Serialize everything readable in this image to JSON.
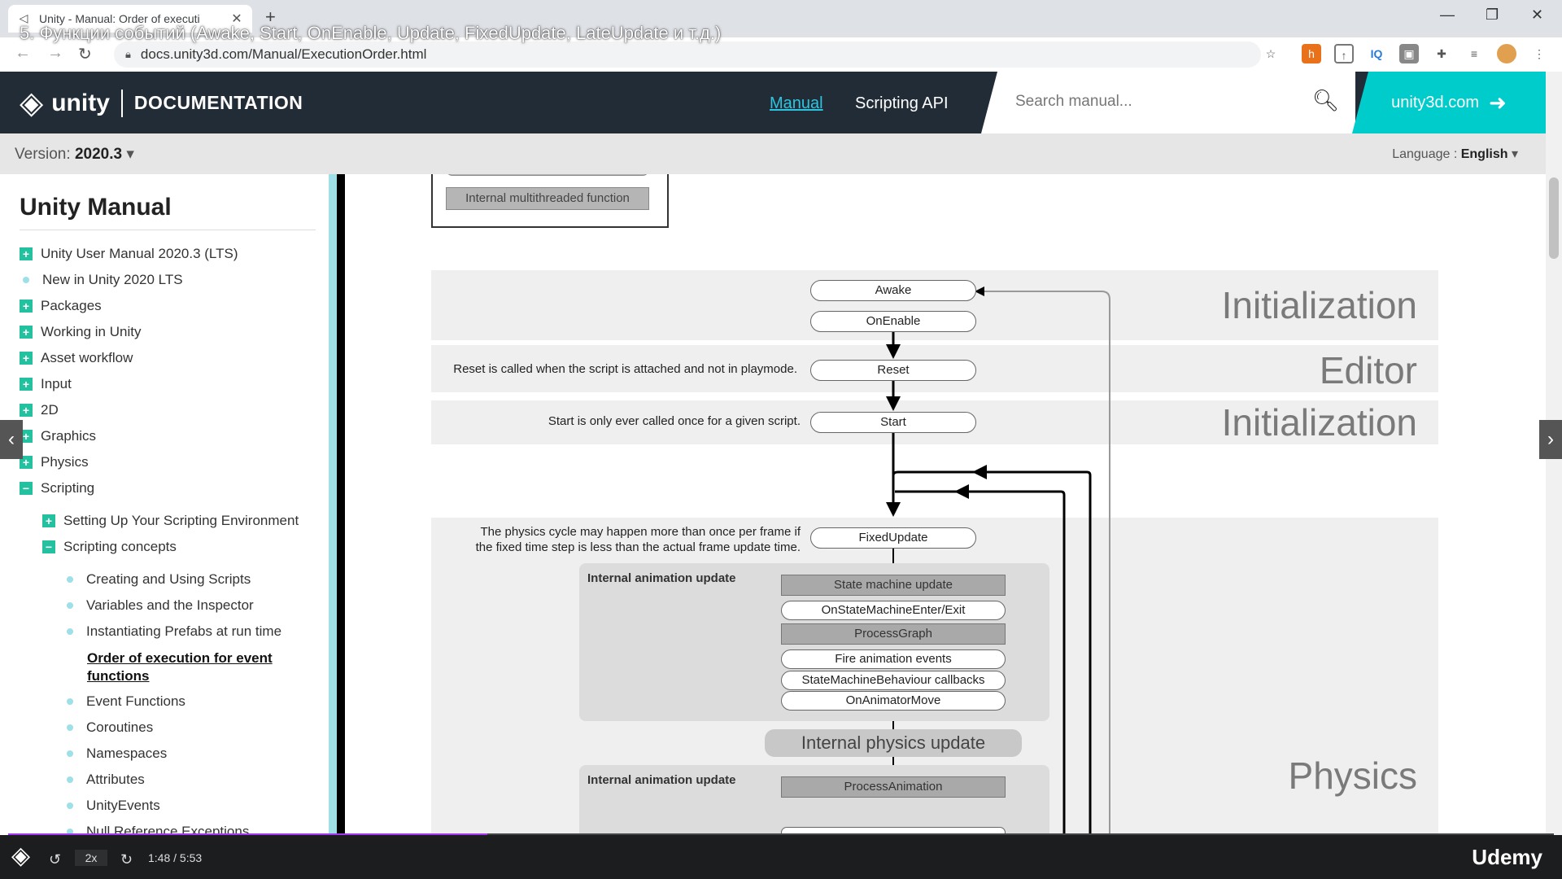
{
  "browser": {
    "tab_title": "Unity - Manual: Order of executi",
    "url": "docs.unity3d.com/Manual/ExecutionOrder.html",
    "video_title": "5. Функции событий (Awake, Start, OnEnable, Update, FixedUpdate, LateUpdate и т.д.)"
  },
  "header": {
    "logo_word": "unity",
    "logo_section": "DOCUMENTATION",
    "nav": {
      "manual": "Manual",
      "scripting_api": "Scripting API"
    },
    "search_placeholder": "Search manual...",
    "cta": "unity3d.com"
  },
  "versionbar": {
    "version_label": "Version: ",
    "version_value": "2020.3",
    "language_label": "Language : ",
    "language_value": "English"
  },
  "sidebar": {
    "title": "Unity Manual",
    "items": [
      {
        "label": "Unity User Manual 2020.3 (LTS)",
        "marker": "plus"
      },
      {
        "label": "New in Unity 2020 LTS",
        "marker": "dot"
      },
      {
        "label": "Packages",
        "marker": "plus"
      },
      {
        "label": "Working in Unity",
        "marker": "plus"
      },
      {
        "label": "Asset workflow",
        "marker": "plus"
      },
      {
        "label": "Input",
        "marker": "plus"
      },
      {
        "label": "2D",
        "marker": "plus"
      },
      {
        "label": "Graphics",
        "marker": "plus"
      },
      {
        "label": "Physics",
        "marker": "plus"
      },
      {
        "label": "Scripting",
        "marker": "minus"
      },
      {
        "label": "Setting Up Your Scripting Environment",
        "marker": "plus"
      },
      {
        "label": "Scripting concepts",
        "marker": "minus"
      },
      {
        "label": "Creating and Using Scripts",
        "marker": "dot"
      },
      {
        "label": "Variables and the Inspector",
        "marker": "dot"
      },
      {
        "label": "Instantiating Prefabs at run time",
        "marker": "dot"
      },
      {
        "label": "Order of execution for event functions",
        "marker": "none"
      },
      {
        "label": "Event Functions",
        "marker": "dot"
      },
      {
        "label": "Coroutines",
        "marker": "dot"
      },
      {
        "label": "Namespaces",
        "marker": "dot"
      },
      {
        "label": "Attributes",
        "marker": "dot"
      },
      {
        "label": "UnityEvents",
        "marker": "dot"
      },
      {
        "label": "Null Reference Exceptions",
        "marker": "dot"
      }
    ]
  },
  "diagram": {
    "legend_internal": "Internal multithreaded function",
    "bands": {
      "init1": "Initialization",
      "editor": "Editor",
      "init2": "Initialization",
      "physics": "Physics"
    },
    "nodes": {
      "awake": "Awake",
      "onenable": "OnEnable",
      "reset": "Reset",
      "start": "Start",
      "fixedupdate": "FixedUpdate",
      "state_machine_update": "State machine update",
      "on_state_machine": "OnStateMachineEnter/Exit",
      "process_graph": "ProcessGraph",
      "fire_anim_events": "Fire animation events",
      "smb_callbacks": "StateMachineBehaviour callbacks",
      "on_animator_move": "OnAnimatorMove",
      "internal_physics": "Internal physics update",
      "process_animation": "ProcessAnimation"
    },
    "notes": {
      "reset": "Reset is called when the script is attached and not in playmode.",
      "start": "Start is only ever called once for a given script.",
      "physics_1": "The physics cycle may happen more than once per frame if",
      "physics_2": "the fixed time step is less than the actual frame update time."
    },
    "panels": {
      "anim1": "Internal animation update",
      "anim2": "Internal animation update"
    }
  },
  "player": {
    "speed": "2x",
    "time": "1:48 / 5:53",
    "brand": "Udemy",
    "progress": 0.31
  }
}
